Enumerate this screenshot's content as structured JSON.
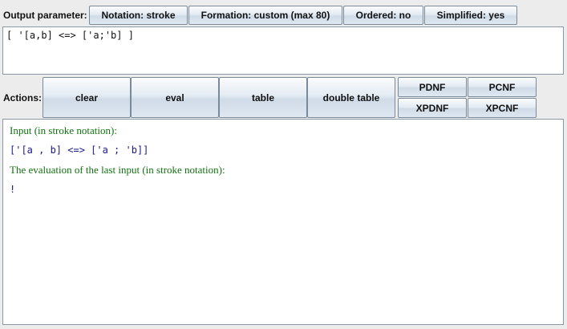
{
  "output_parameter": {
    "label": "Output parameter:",
    "notation": "Notation: stroke",
    "formation": "Formation: custom (max 80)",
    "ordered": "Ordered: no",
    "simplified": "Simplified: yes"
  },
  "formula": {
    "value": "[ '[a,b] <=> ['a;'b] ]"
  },
  "actions": {
    "label": "Actions:",
    "clear": "clear",
    "eval": "eval",
    "table": "table",
    "double_table": "double table",
    "pdnf": "PDNF",
    "pcnf": "PCNF",
    "xpdnf": "XPDNF",
    "xpcnf": "XPCNF"
  },
  "output": {
    "input_heading": "Input (in stroke notation):",
    "input_value": "['[a , b] <=> ['a ; 'b]]",
    "eval_heading": "The evaluation of the last input (in stroke notation):",
    "eval_value": "!"
  },
  "colors": {
    "heading_green": "#107010",
    "value_blue": "#1a1a8a"
  }
}
